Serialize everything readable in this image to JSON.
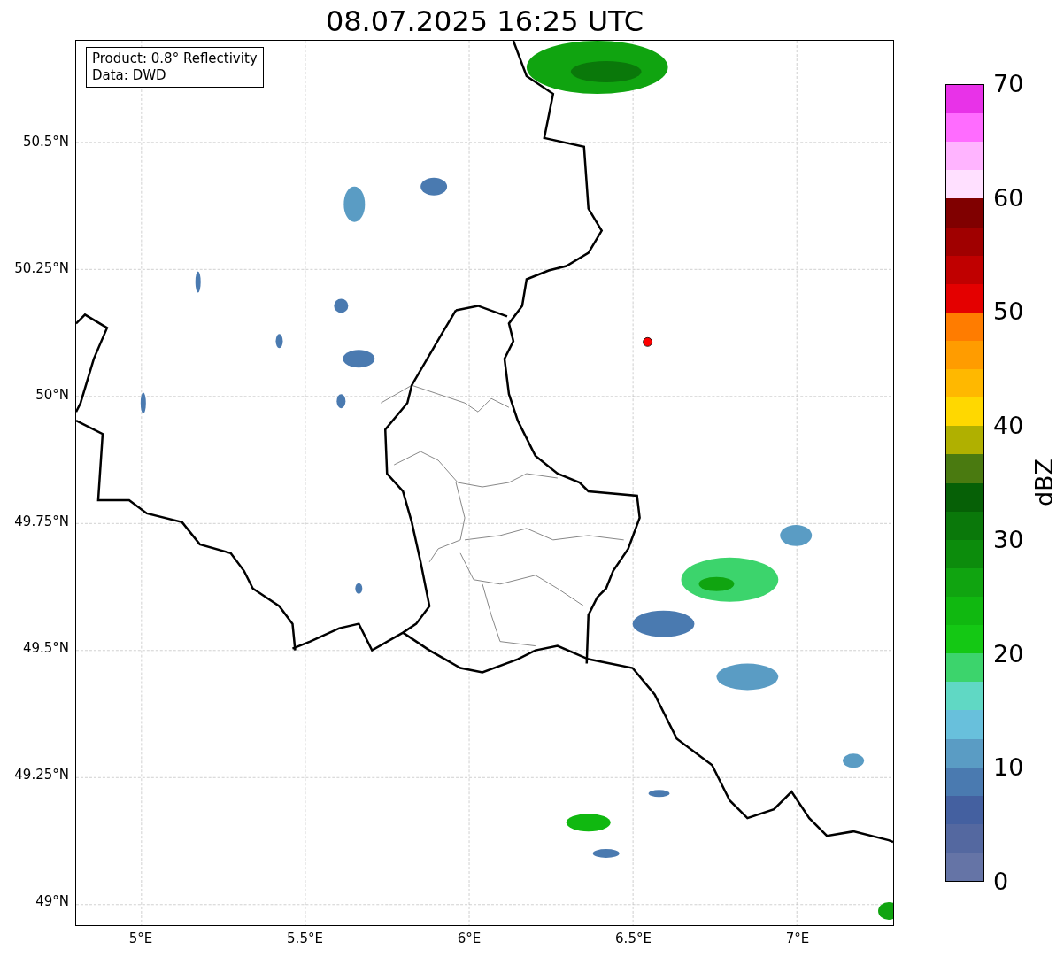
{
  "title": "08.07.2025 16:25 UTC",
  "legend": {
    "lines": [
      "Product: 0.8° Reflectivity",
      "Data: DWD"
    ]
  },
  "y_ticks": [
    "50.5°N",
    "50.25°N",
    "50°N",
    "49.75°N",
    "49.5°N",
    "49.25°N",
    "49°N"
  ],
  "x_ticks": [
    "5°E",
    "5.5°E",
    "6°E",
    "6.5°E",
    "7°E"
  ],
  "colorbar": {
    "label": "dBZ",
    "ticks": [
      "70",
      "60",
      "50",
      "40",
      "30",
      "20",
      "10",
      "0"
    ],
    "segments": [
      {
        "color": "#e832e8"
      },
      {
        "color": "#ff6cff"
      },
      {
        "color": "#ffb4ff"
      },
      {
        "color": "#ffe0ff"
      },
      {
        "color": "#800000"
      },
      {
        "color": "#a00000"
      },
      {
        "color": "#c00000"
      },
      {
        "color": "#e40000"
      },
      {
        "color": "#ff7c00"
      },
      {
        "color": "#ff9c00"
      },
      {
        "color": "#ffb800"
      },
      {
        "color": "#ffd800"
      },
      {
        "color": "#b0b000"
      },
      {
        "color": "#4a7a10"
      },
      {
        "color": "#066006"
      },
      {
        "color": "#0a780a"
      },
      {
        "color": "#0c8c0c"
      },
      {
        "color": "#10a410"
      },
      {
        "color": "#10b810"
      },
      {
        "color": "#14c814"
      },
      {
        "color": "#3cd46c"
      },
      {
        "color": "#60d8c4"
      },
      {
        "color": "#68c0dc"
      },
      {
        "color": "#5a9cc4"
      },
      {
        "color": "#4a7ab0"
      },
      {
        "color": "#4460a0"
      },
      {
        "color": "#5468a0"
      },
      {
        "color": "#6574a6"
      }
    ]
  }
}
